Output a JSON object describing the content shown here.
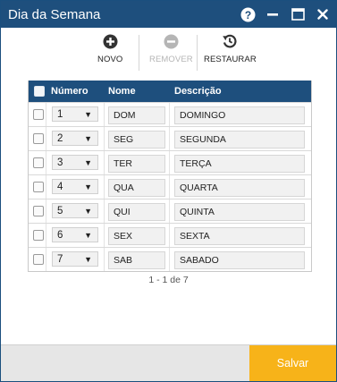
{
  "window": {
    "title": "Dia da Semana",
    "help_icon": "help-circle-icon",
    "minimize_icon": "minimize-icon",
    "maximize_icon": "maximize-icon",
    "close_icon": "close-icon"
  },
  "toolbar": {
    "novo_label": "NOVO",
    "remover_label": "REMOVER",
    "restaurar_label": "RESTAURAR"
  },
  "table": {
    "headers": {
      "numero": "Número",
      "nome": "Nome",
      "descricao": "Descrição"
    },
    "rows": [
      {
        "numero": "1",
        "nome": "DOM",
        "descricao": "DOMINGO"
      },
      {
        "numero": "2",
        "nome": "SEG",
        "descricao": "SEGUNDA"
      },
      {
        "numero": "3",
        "nome": "TER",
        "descricao": "TERÇA"
      },
      {
        "numero": "4",
        "nome": "QUA",
        "descricao": "QUARTA"
      },
      {
        "numero": "5",
        "nome": "QUI",
        "descricao": "QUINTA"
      },
      {
        "numero": "6",
        "nome": "SEX",
        "descricao": "SEXTA"
      },
      {
        "numero": "7",
        "nome": "SAB",
        "descricao": "SABADO"
      }
    ]
  },
  "pager": {
    "text": "1 - 1 de 7"
  },
  "footer": {
    "save_label": "Salvar"
  },
  "colors": {
    "header_blue": "#1e4f7d",
    "save_orange": "#f7b319",
    "footer_gray": "#e6e6e6"
  }
}
